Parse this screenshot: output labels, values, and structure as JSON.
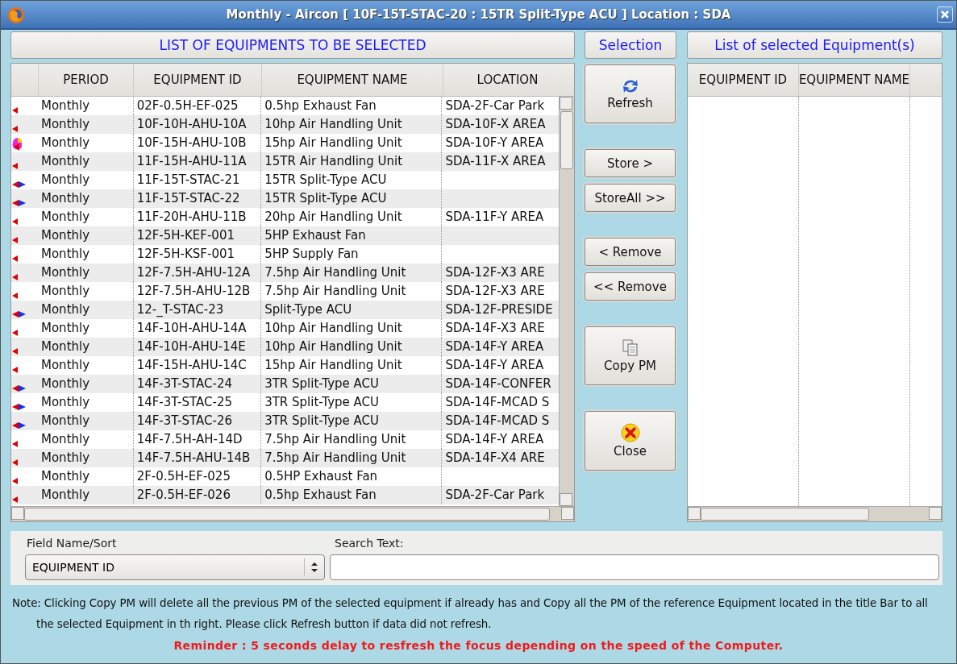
{
  "window": {
    "title": "Monthly - Aircon [ 10F-15T-STAC-20 : 15TR Split-Type ACU ] Location : SDA"
  },
  "left_panel": {
    "heading": "LIST OF EQUIPMENTS TO BE SELECTED",
    "columns": [
      "PERIOD",
      "EQUIPMENT ID",
      "EQUIPMENT NAME",
      "LOCATION"
    ],
    "rows": [
      {
        "kind": "left",
        "period": "Monthly",
        "equipment_id": "02F-0.5H-EF-025",
        "equipment_name": "0.5hp Exhaust Fan",
        "location": "SDA-2F-Car Park"
      },
      {
        "kind": "left",
        "period": "Monthly",
        "equipment_id": "10F-10H-AHU-10A",
        "equipment_name": "10hp Air Handling Unit",
        "location": "SDA-10F-X AREA"
      },
      {
        "kind": "pie",
        "period": "Monthly",
        "equipment_id": "10F-15H-AHU-10B",
        "equipment_name": "15hp Air Handling Unit",
        "location": "SDA-10F-Y AREA"
      },
      {
        "kind": "left",
        "period": "Monthly",
        "equipment_id": "11F-15H-AHU-11A",
        "equipment_name": "15TR Air Handling Unit",
        "location": "SDA-11F-X AREA"
      },
      {
        "kind": "both",
        "period": "Monthly",
        "equipment_id": "11F-15T-STAC-21",
        "equipment_name": "15TR Split-Type ACU"
      },
      {
        "kind": "both",
        "period": "Monthly",
        "equipment_id": "11F-15T-STAC-22",
        "equipment_name": "15TR Split-Type ACU"
      },
      {
        "kind": "left",
        "period": "Monthly",
        "equipment_id": "11F-20H-AHU-11B",
        "equipment_name": "20hp Air Handling Unit",
        "location": "SDA-11F-Y AREA"
      },
      {
        "kind": "left",
        "period": "Monthly",
        "equipment_id": "12F-5H-KEF-001",
        "equipment_name": "5HP Exhaust Fan"
      },
      {
        "kind": "left",
        "period": "Monthly",
        "equipment_id": "12F-5H-KSF-001",
        "equipment_name": "5HP Supply Fan"
      },
      {
        "kind": "left",
        "period": "Monthly",
        "equipment_id": "12F-7.5H-AHU-12A",
        "equipment_name": "7.5hp Air Handling Unit",
        "location": "SDA-12F-X3 ARE"
      },
      {
        "kind": "left",
        "period": "Monthly",
        "equipment_id": "12F-7.5H-AHU-12B",
        "equipment_name": "7.5hp Air Handling Unit",
        "location": "SDA-12F-X3 ARE"
      },
      {
        "kind": "both",
        "period": "Monthly",
        "equipment_id": "12-_T-STAC-23",
        "equipment_name": "Split-Type ACU",
        "location": "SDA-12F-PRESIDE"
      },
      {
        "kind": "left",
        "period": "Monthly",
        "equipment_id": "14F-10H-AHU-14A",
        "equipment_name": "10hp Air Handling Unit",
        "location": "SDA-14F-X3 ARE"
      },
      {
        "kind": "left",
        "period": "Monthly",
        "equipment_id": "14F-10H-AHU-14E",
        "equipment_name": "10hp Air Handling Unit",
        "location": "SDA-14F-Y AREA"
      },
      {
        "kind": "left",
        "period": "Monthly",
        "equipment_id": "14F-15H-AHU-14C",
        "equipment_name": "15hp Air Handling Unit",
        "location": "SDA-14F-Y AREA"
      },
      {
        "kind": "both",
        "period": "Monthly",
        "equipment_id": "14F-3T-STAC-24",
        "equipment_name": "3TR Split-Type ACU",
        "location": "SDA-14F-CONFER"
      },
      {
        "kind": "both",
        "period": "Monthly",
        "equipment_id": "14F-3T-STAC-25",
        "equipment_name": "3TR Split-Type ACU",
        "location": "SDA-14F-MCAD S"
      },
      {
        "kind": "both",
        "period": "Monthly",
        "equipment_id": "14F-3T-STAC-26",
        "equipment_name": "3TR Split-Type ACU",
        "location": "SDA-14F-MCAD S"
      },
      {
        "kind": "left",
        "period": "Monthly",
        "equipment_id": "14F-7.5H-AH-14D",
        "equipment_name": "7.5hp Air Handling Unit",
        "location": "SDA-14F-Y AREA"
      },
      {
        "kind": "left",
        "period": "Monthly",
        "equipment_id": "14F-7.5H-AHU-14B",
        "equipment_name": "7.5hp Air Handling Unit",
        "location": "SDA-14F-X4 ARE"
      },
      {
        "kind": "left",
        "period": "Monthly",
        "equipment_id": "2F-0.5H-EF-025",
        "equipment_name": "0.5HP Exhaust Fan"
      },
      {
        "kind": "left",
        "period": "Monthly",
        "equipment_id": "2F-0.5H-EF-026",
        "equipment_name": "0.5hp Exhaust Fan",
        "location": "SDA-2F-Car Park"
      }
    ]
  },
  "selection": {
    "heading": "Selection",
    "button_groups": [
      [
        {
          "label": "Refresh",
          "kind": "refresh"
        }
      ],
      [
        {
          "label": "Store >",
          "kind": "plain"
        },
        {
          "label": "StoreAll >>",
          "kind": "plain"
        }
      ],
      [
        {
          "label": "< Remove",
          "kind": "plain"
        },
        {
          "label": "<< Remove",
          "kind": "plain"
        }
      ],
      [
        {
          "label": "Copy PM",
          "kind": "copy"
        }
      ],
      [
        {
          "label": "Close",
          "kind": "close"
        }
      ]
    ]
  },
  "right_panel": {
    "heading": "List of selected Equipment(s)",
    "columns": [
      "EQUIPMENT ID",
      "EQUIPMENT NAME"
    ]
  },
  "search": {
    "field_label": "Field Name/Sort",
    "field_value": "EQUIPMENT ID",
    "text_label": "Search Text:"
  },
  "note": "Note: Clicking Copy PM will delete all the previous PM of the selected equipment if already has and Copy all the PM of the reference Equipment located in the title Bar to all the selected Equipment in th right. Please click Refresh button if data did not refresh.",
  "reminder": "Reminder : 5 seconds delay to resfresh the focus depending on the speed of the Computer."
}
